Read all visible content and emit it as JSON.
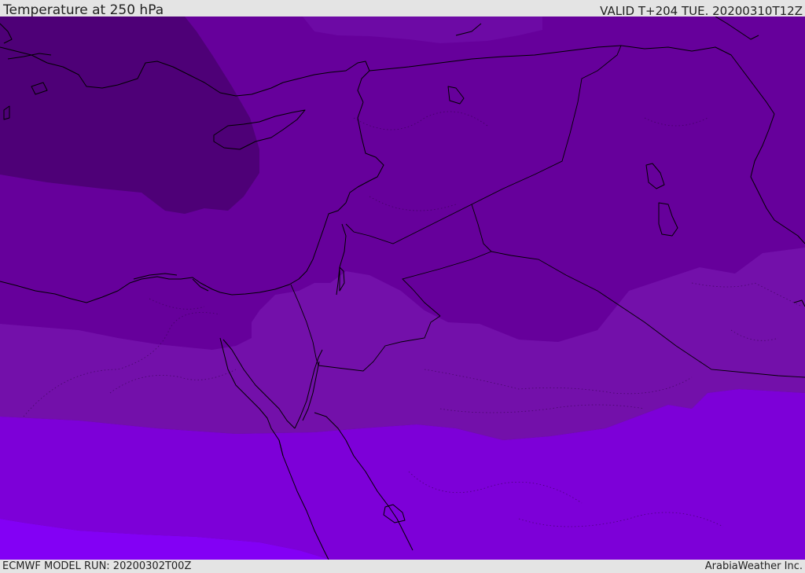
{
  "header": {
    "title": "Temperature at 250 hPa",
    "valid": "VALID T+204 TUE. 20200310T12Z"
  },
  "footer": {
    "model_run": "ECMWF MODEL RUN: 20200302T00Z",
    "credit": "ArabiaWeather Inc."
  },
  "map": {
    "colors": {
      "darkest": "#4e0077",
      "dark": "#5f0090",
      "mid_dark": "#66009b",
      "mid": "#7310aa",
      "bright": "#7d00d8",
      "brightest": "#8300f5",
      "coastline": "#000000"
    }
  }
}
